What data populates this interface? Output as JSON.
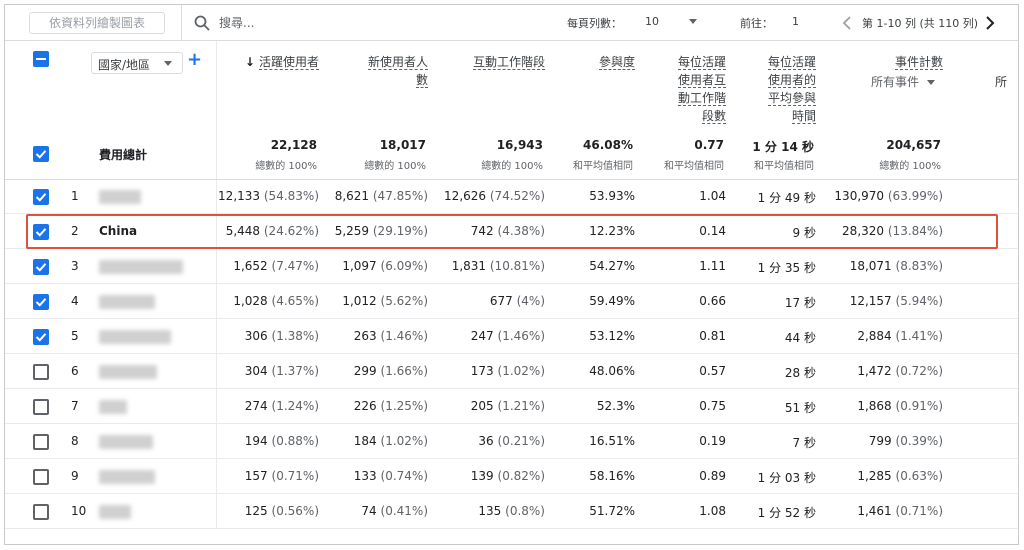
{
  "toolbar": {
    "chart_button_label": "依資料列繪製圖表",
    "search_placeholder": "搜尋...",
    "rows_per_page_label": "每頁列數：",
    "rows_per_page_value": "10",
    "goto_label": "前往：",
    "goto_value": "1",
    "page_info": "第 1-10 列 (共 110 列)"
  },
  "header": {
    "dimension_label": "國家/地區",
    "add_label": "+",
    "columns": [
      {
        "name": "活躍使用者",
        "sorted": true,
        "lines": [
          "活躍使用者"
        ]
      },
      {
        "name": "新使用者人數",
        "lines": [
          "新使用者人",
          "數"
        ]
      },
      {
        "name": "互動工作階段",
        "lines": [
          "互動工作階段"
        ]
      },
      {
        "name": "參與度",
        "lines": [
          "參與度"
        ]
      },
      {
        "name": "每位活躍使用者互動工作階段數",
        "lines": [
          "每位活躍",
          "使用者互",
          "動工作階",
          "段數"
        ]
      },
      {
        "name": "每位活躍使用者的平均參與時間",
        "lines": [
          "每位活躍",
          "使用者的",
          "平均參與",
          "時間"
        ]
      },
      {
        "name": "事件計數",
        "lines": [
          "事件計數"
        ],
        "sub": "所有事件"
      }
    ],
    "clipped_col": "所"
  },
  "totals": {
    "label": "費用總計",
    "values": [
      {
        "value": "22,128",
        "sub": "總數的 100%"
      },
      {
        "value": "18,017",
        "sub": "總數的 100%"
      },
      {
        "value": "16,943",
        "sub": "總數的 100%"
      },
      {
        "value": "46.08%",
        "sub": "和平均值相同"
      },
      {
        "value": "0.77",
        "sub": "和平均值相同"
      },
      {
        "value": "1 分 14 秒",
        "sub": "和平均值相同"
      },
      {
        "value": "204,657",
        "sub": "總數的 100%"
      }
    ]
  },
  "rows": [
    {
      "idx": "1",
      "country": "",
      "checked": true,
      "cells": [
        "12,133",
        "(54.83%)",
        "8,621",
        "(47.85%)",
        "12,626",
        "(74.52%)",
        "53.93%",
        "1.04",
        "1 分 49 秒",
        "130,970",
        "(63.99%)"
      ]
    },
    {
      "idx": "2",
      "country": "China",
      "checked": true,
      "cells": [
        "5,448",
        "(24.62%)",
        "5,259",
        "(29.19%)",
        "742",
        "(4.38%)",
        "12.23%",
        "0.14",
        "9 秒",
        "28,320",
        "(13.84%)"
      ]
    },
    {
      "idx": "3",
      "country": "",
      "checked": true,
      "cells": [
        "1,652",
        "(7.47%)",
        "1,097",
        "(6.09%)",
        "1,831",
        "(10.81%)",
        "54.27%",
        "1.11",
        "1 分 35 秒",
        "18,071",
        "(8.83%)"
      ]
    },
    {
      "idx": "4",
      "country": "",
      "checked": true,
      "cells": [
        "1,028",
        "(4.65%)",
        "1,012",
        "(5.62%)",
        "677",
        "(4%)",
        "59.49%",
        "0.66",
        "17 秒",
        "12,157",
        "(5.94%)"
      ]
    },
    {
      "idx": "5",
      "country": "",
      "checked": true,
      "cells": [
        "306",
        "(1.38%)",
        "263",
        "(1.46%)",
        "247",
        "(1.46%)",
        "53.12%",
        "0.81",
        "44 秒",
        "2,884",
        "(1.41%)"
      ]
    },
    {
      "idx": "6",
      "country": "",
      "checked": false,
      "cells": [
        "304",
        "(1.37%)",
        "299",
        "(1.66%)",
        "173",
        "(1.02%)",
        "48.06%",
        "0.57",
        "28 秒",
        "1,472",
        "(0.72%)"
      ]
    },
    {
      "idx": "7",
      "country": "",
      "checked": false,
      "cells": [
        "274",
        "(1.24%)",
        "226",
        "(1.25%)",
        "205",
        "(1.21%)",
        "52.3%",
        "0.75",
        "51 秒",
        "1,868",
        "(0.91%)"
      ]
    },
    {
      "idx": "8",
      "country": "",
      "checked": false,
      "cells": [
        "194",
        "(0.88%)",
        "184",
        "(1.02%)",
        "36",
        "(0.21%)",
        "16.51%",
        "0.19",
        "7 秒",
        "799",
        "(0.39%)"
      ]
    },
    {
      "idx": "9",
      "country": "",
      "checked": false,
      "cells": [
        "157",
        "(0.71%)",
        "133",
        "(0.74%)",
        "139",
        "(0.82%)",
        "58.16%",
        "0.89",
        "1 分 03 秒",
        "1,285",
        "(0.63%)"
      ]
    },
    {
      "idx": "10",
      "country": "",
      "checked": false,
      "cells": [
        "125",
        "(0.56%)",
        "74",
        "(0.41%)",
        "135",
        "(0.8%)",
        "51.72%",
        "1.08",
        "1 分 52 秒",
        "1,461",
        "(0.71%)"
      ]
    }
  ],
  "colors": {
    "accent": "#1a73e8",
    "highlight": "#e0513c"
  }
}
